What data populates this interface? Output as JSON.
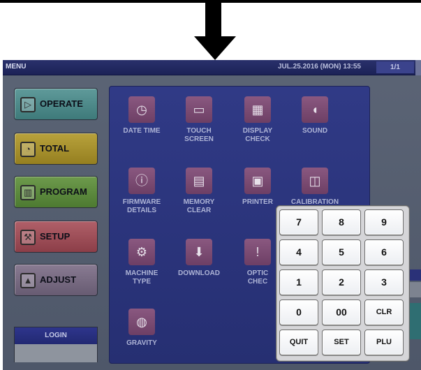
{
  "titlebar": {
    "menu": "MENU",
    "datetime": "JUL.25.2016 (MON) 13:55",
    "page": "1/1"
  },
  "nav": [
    {
      "label": "OPERATE",
      "icon": "play-icon"
    },
    {
      "label": "TOTAL",
      "icon": "clock-icon"
    },
    {
      "label": "PROGRAM",
      "icon": "book-icon"
    },
    {
      "label": "SETUP",
      "icon": "wrench-icon"
    },
    {
      "label": "ADJUST",
      "icon": "adjust-icon"
    }
  ],
  "login": {
    "label": "LOGIN"
  },
  "tiles": [
    {
      "line1": "DATE TIME",
      "line2": "",
      "icon": "calendar-clock-icon"
    },
    {
      "line1": "TOUCH",
      "line2": "SCREEN",
      "icon": "monitor-icon"
    },
    {
      "line1": "DISPLAY",
      "line2": "CHECK",
      "icon": "color-bars-icon"
    },
    {
      "line1": "SOUND",
      "line2": "",
      "icon": "speaker-icon"
    },
    {
      "line1": "FIRMWARE",
      "line2": "DETAILS",
      "icon": "info-icon"
    },
    {
      "line1": "MEMORY",
      "line2": "CLEAR",
      "icon": "folder-clear-icon"
    },
    {
      "line1": "PRINTER",
      "line2": "",
      "icon": "printer-icon"
    },
    {
      "line1": "CALIBRATION",
      "line2": "",
      "icon": "calibration-icon"
    },
    {
      "line1": "MACHINE",
      "line2": "TYPE",
      "icon": "gears-icon"
    },
    {
      "line1": "DOWNLOAD",
      "line2": "",
      "icon": "download-icon"
    },
    {
      "line1": "OPTIC",
      "line2": "CHEC",
      "icon": "optic-icon"
    },
    {
      "line1": "GRAVITY",
      "line2": "",
      "icon": "gravity-icon"
    }
  ],
  "keypad": {
    "keys": [
      "7",
      "8",
      "9",
      "4",
      "5",
      "6",
      "1",
      "2",
      "3",
      "0",
      "00",
      "CLR",
      "QUIT",
      "SET",
      "PLU"
    ]
  }
}
